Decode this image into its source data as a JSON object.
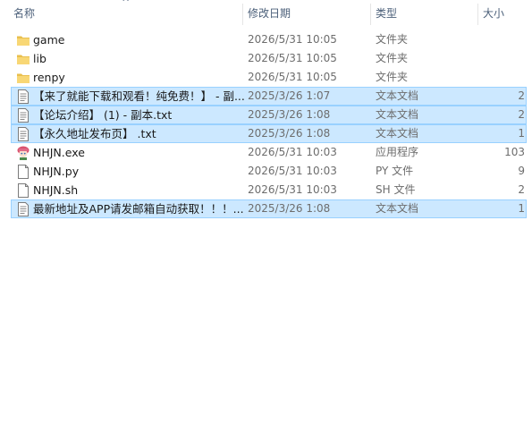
{
  "header": {
    "name_label": "名称",
    "date_label": "修改日期",
    "type_label": "类型",
    "size_label": "大小",
    "sort_glyph": "^"
  },
  "colors": {
    "selection_bg": "#cce8ff",
    "selection_border": "#99d1ff",
    "folder": "#f8d775"
  },
  "files": [
    {
      "name": "game",
      "date": "2026/5/31 10:05",
      "type": "文件夹",
      "size": "",
      "icon": "folder-icon",
      "selected": false
    },
    {
      "name": "lib",
      "date": "2026/5/31 10:05",
      "type": "文件夹",
      "size": "",
      "icon": "folder-icon",
      "selected": false
    },
    {
      "name": "renpy",
      "date": "2026/5/31 10:05",
      "type": "文件夹",
      "size": "",
      "icon": "folder-icon",
      "selected": false
    },
    {
      "name": "【来了就能下载和观看！纯免费！】 - 副...",
      "date": "2025/3/26 1:07",
      "type": "文本文档",
      "size": "2",
      "icon": "text-document-icon",
      "selected": true
    },
    {
      "name": "【论坛介绍】 (1) - 副本.txt",
      "date": "2025/3/26 1:08",
      "type": "文本文档",
      "size": "2",
      "icon": "text-document-icon",
      "selected": true
    },
    {
      "name": "【永久地址发布页】 .txt",
      "date": "2025/3/26 1:08",
      "type": "文本文档",
      "size": "1",
      "icon": "text-document-icon",
      "selected": true
    },
    {
      "name": "NHJN.exe",
      "date": "2026/5/31 10:03",
      "type": "应用程序",
      "size": "103",
      "icon": "application-icon",
      "selected": false
    },
    {
      "name": "NHJN.py",
      "date": "2026/5/31 10:03",
      "type": "PY 文件",
      "size": "9",
      "icon": "file-icon",
      "selected": false
    },
    {
      "name": "NHJN.sh",
      "date": "2026/5/31 10:03",
      "type": "SH 文件",
      "size": "2",
      "icon": "file-icon",
      "selected": false
    },
    {
      "name": "最新地址及APP请发邮箱自动获取！！！...",
      "date": "2025/3/26 1:08",
      "type": "文本文档",
      "size": "1",
      "icon": "text-document-icon",
      "selected": true
    }
  ]
}
